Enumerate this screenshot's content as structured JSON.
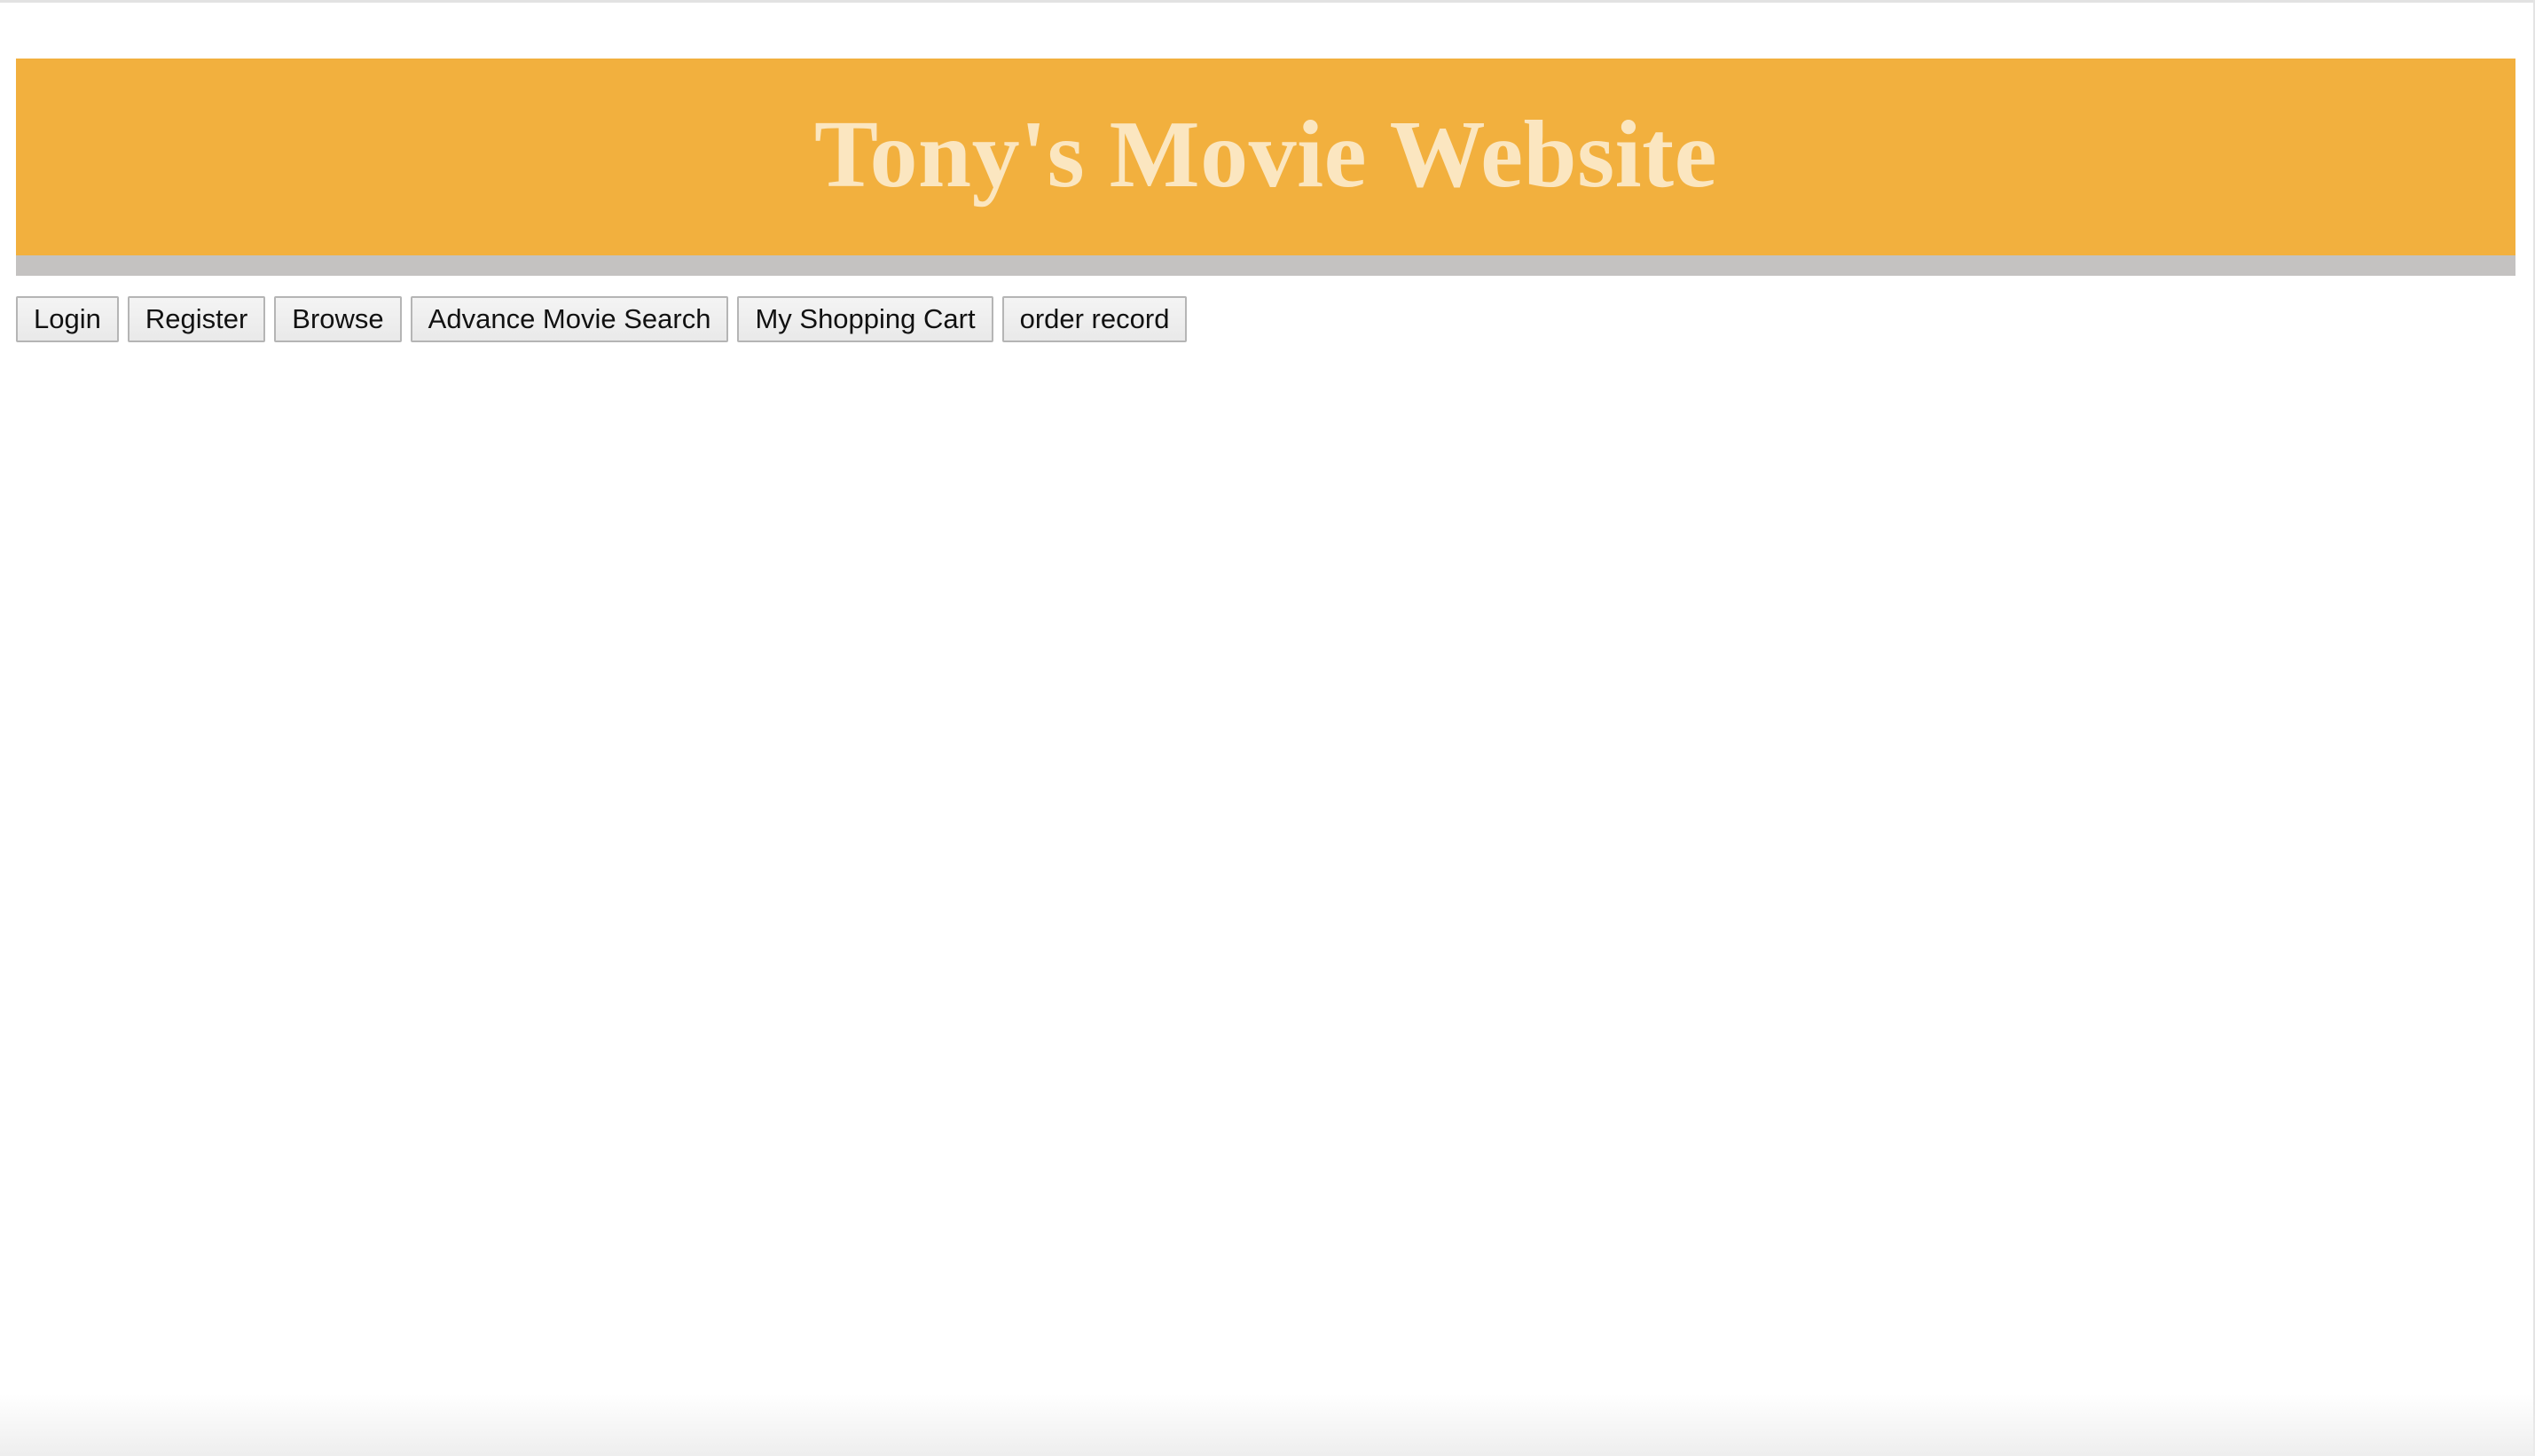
{
  "header": {
    "title": "Tony's Movie Website",
    "background_color": "#f2b03e",
    "title_color": "#fbe6c0",
    "underbar_color": "#c4c2c1"
  },
  "nav": {
    "buttons": [
      {
        "label": "Login"
      },
      {
        "label": "Register"
      },
      {
        "label": "Browse"
      },
      {
        "label": "Advance Movie Search"
      },
      {
        "label": "My Shopping Cart"
      },
      {
        "label": "order record"
      }
    ]
  }
}
